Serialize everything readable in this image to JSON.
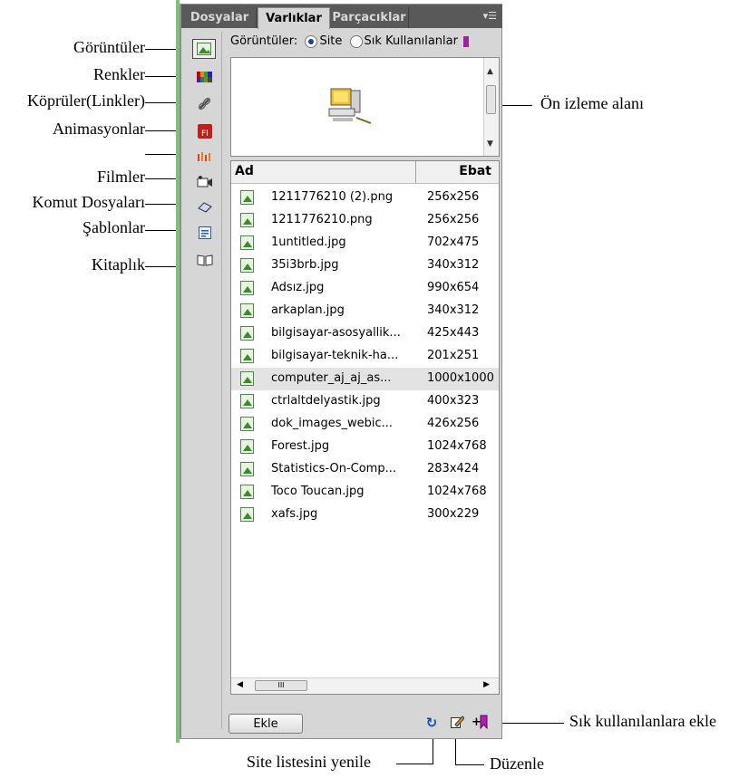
{
  "tabs": [
    {
      "label": "Dosyalar"
    },
    {
      "label": "Varlıklar"
    },
    {
      "label": "Parçacıklar"
    }
  ],
  "tab_menu_icon": "panel-menu-icon",
  "toprow": {
    "label": "Görüntüler:",
    "option_site": "Site",
    "option_fav": "Sık Kullanılanlar"
  },
  "list": {
    "col_name": "Ad",
    "col_size": "Ebat",
    "rows": [
      {
        "name": "1211776210 (2).png",
        "size": "256x256"
      },
      {
        "name": "1211776210.png",
        "size": "256x256"
      },
      {
        "name": "1untitled.jpg",
        "size": "702x475"
      },
      {
        "name": "35i3brb.jpg",
        "size": "340x312"
      },
      {
        "name": "Adsız.jpg",
        "size": "990x654"
      },
      {
        "name": "arkaplan.jpg",
        "size": "340x312"
      },
      {
        "name": "bilgisayar-asosyallik...",
        "size": "425x443"
      },
      {
        "name": "bilgisayar-teknik-ha...",
        "size": "201x251"
      },
      {
        "name": "computer_aj_aj_as...",
        "size": "1000x1000"
      },
      {
        "name": "ctrlaltdelyastik.jpg",
        "size": "400x323"
      },
      {
        "name": "dok_images_webic...",
        "size": "426x256"
      },
      {
        "name": "Forest.jpg",
        "size": "1024x768"
      },
      {
        "name": "Statistics-On-Comp...",
        "size": "283x424"
      },
      {
        "name": "Toco Toucan.jpg",
        "size": "1024x768"
      },
      {
        "name": "xafs.jpg",
        "size": "300x229"
      }
    ],
    "hscroll_thumb": "III"
  },
  "bottom": {
    "ekle_label": "Ekle"
  },
  "annotations": {
    "goruntuler": "Görüntüler",
    "renkler": "Renkler",
    "kopruler": "Köprüler(Linkler)",
    "animasyonlar": "Animasyonlar",
    "filmler": "Filmler",
    "komut": "Komut Dosyaları",
    "sablonlar": "Şablonlar",
    "kitaplik": "Kitaplık",
    "onizleme": "Ön izleme alanı",
    "sik": "Sık kullanılanlara ekle",
    "yenile": "Site listesini yenile",
    "duzenle": "Düzenle"
  },
  "colors": {
    "tabbar": "#595959",
    "panel": "#d6d6d6",
    "accent_blue": "#1f3fa8",
    "fav_purple": "#a020a0"
  }
}
